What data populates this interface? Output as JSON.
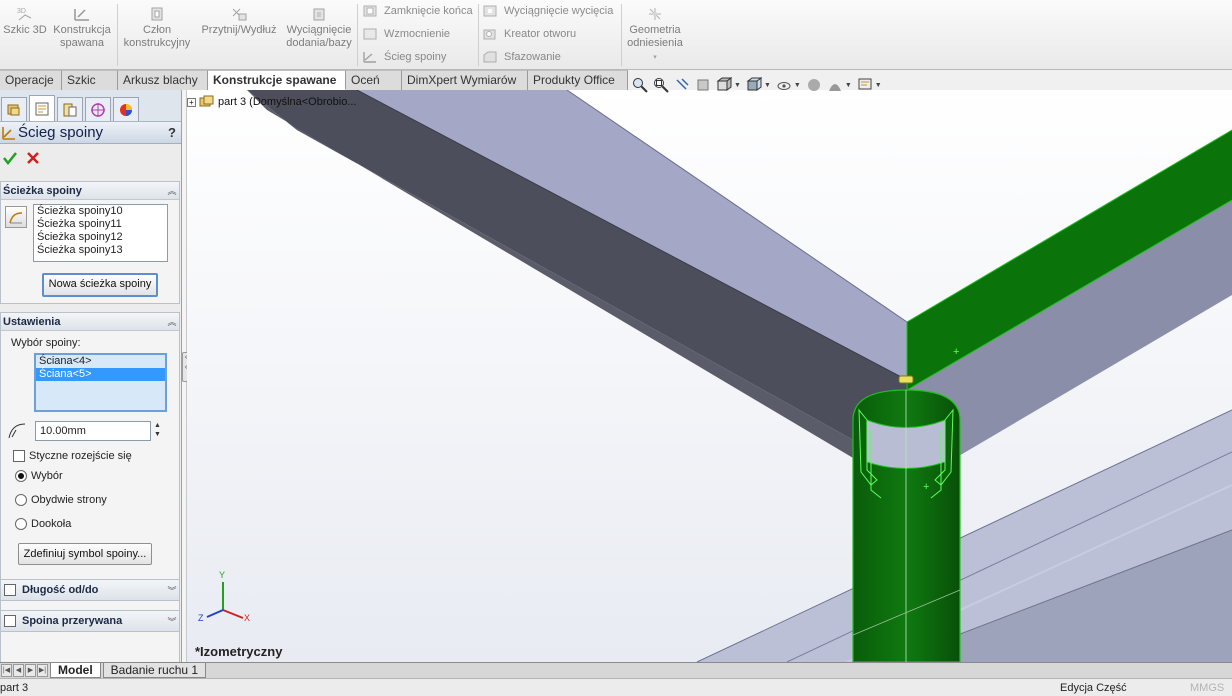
{
  "ribbon": {
    "sketch3d": "Szkic 3D",
    "weld_structure": [
      "Konstrukcja",
      "spawana"
    ],
    "structural_member": [
      "Człon",
      "konstrukcyjny"
    ],
    "trim_extend": "Przytnij/Wydłuż",
    "extruded_boss": [
      "Wyciągnięcie",
      "dodania/bazy"
    ],
    "end_cap": "Zamknięcie końca",
    "gusset": "Wzmocnienie",
    "weld_bead": "Ścieg spoiny",
    "extruded_cut": "Wyciągnięcie wycięcia",
    "hole_wizard": "Kreator otworu",
    "chamfer": "Sfazowanie",
    "ref_geometry": [
      "Geometria",
      "odniesienia"
    ]
  },
  "command_tabs": [
    {
      "label": "Operacje",
      "active": false
    },
    {
      "label": "Szkic",
      "active": false
    },
    {
      "label": "Arkusz blachy",
      "active": false
    },
    {
      "label": "Konstrukcje spawane",
      "active": true
    },
    {
      "label": "Oceń",
      "active": false
    },
    {
      "label": "DimXpert Wymiarów",
      "active": false
    },
    {
      "label": "Produkty Office",
      "active": false
    }
  ],
  "property_manager": {
    "title": "Ścieg spoiny",
    "help": "?",
    "weld_path_group": {
      "title": "Ścieżka spoiny",
      "items": [
        "Ścieżka spoiny10",
        "Ścieżka spoiny11",
        "Ścieżka spoiny12",
        "Ścieżka spoiny13"
      ],
      "new_path_button": "Nowa ścieżka spoiny"
    },
    "settings_group": {
      "title": "Ustawienia",
      "selection_label": "Wybór spoiny:",
      "faces": [
        "Ściana<4>",
        "Ściana<5>"
      ],
      "selected_face_index": 1,
      "bead_size": "10.00mm",
      "tangent_propagation": "Styczne rozejście się",
      "tangent_checked": false,
      "options": [
        "Wybór",
        "Obydwie strony",
        "Dookoła"
      ],
      "selected_option_index": 0,
      "define_symbol_button": "Zdefiniuj symbol spoiny..."
    },
    "from_to_length": "Długość od/do",
    "intermittent_weld": "Spoina przerywana"
  },
  "viewport": {
    "tree_node": "part 3  (Domyślna<Obrobio...",
    "view_orientation": "*Izometryczny",
    "triad": {
      "x": "X",
      "y": "Y",
      "z": "Z"
    },
    "colors": {
      "highlight": "#0a7a0a",
      "beam_top": "#a2a6c4",
      "beam_side": "#4a4c58"
    }
  },
  "bottom_tabs": [
    {
      "label": "Model",
      "active": true
    },
    {
      "label": "Badanie ruchu 1",
      "active": false
    }
  ],
  "status": {
    "left": "part 3",
    "mode": "Edycja Część",
    "units": "MMGS"
  }
}
